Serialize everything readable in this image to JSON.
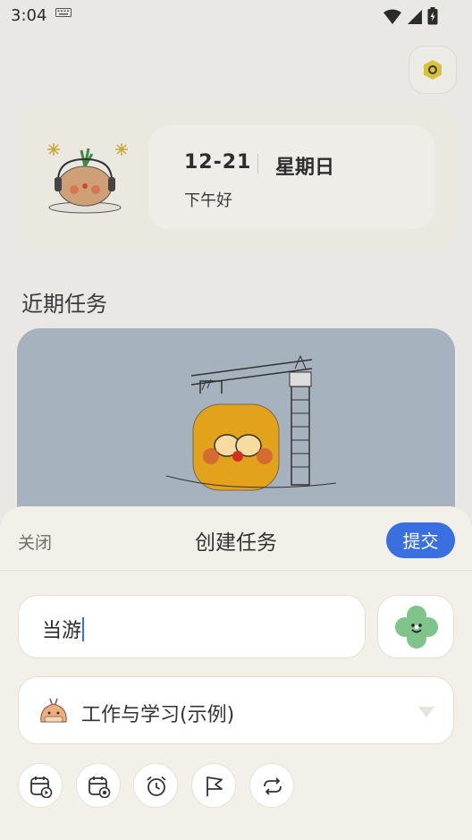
{
  "status_bar": {
    "time": "3:04"
  },
  "home": {
    "date": "12-21",
    "weekday": "星期日",
    "greeting": "下午好",
    "section_title": "近期任务"
  },
  "sheet": {
    "close_label": "关闭",
    "title": "创建任务",
    "submit_label": "提交",
    "task_input_value": "当游",
    "category_label": "工作与学习(示例)",
    "tools": [
      "start-date-icon",
      "due-date-icon",
      "alarm-icon",
      "flag-icon",
      "repeat-icon"
    ]
  },
  "colors": {
    "accent": "#3a6fe0",
    "sheet_bg": "#f3f0ea",
    "task_card_bg": "#a6b2be"
  }
}
